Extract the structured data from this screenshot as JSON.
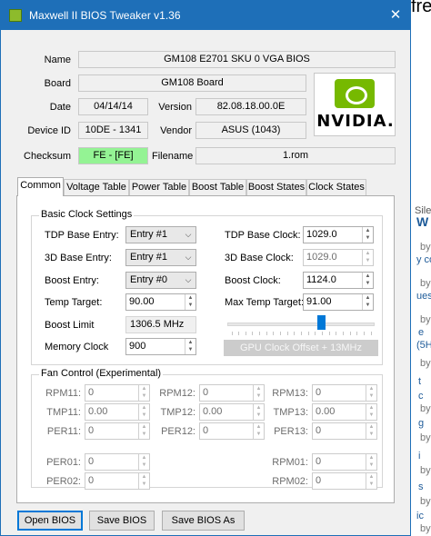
{
  "window": {
    "title": "Maxwell II BIOS Tweaker v1.36"
  },
  "info": {
    "name_label": "Name",
    "name_value": "GM108 E2701 SKU 0 VGA BIOS",
    "board_label": "Board",
    "board_value": "GM108 Board",
    "date_label": "Date",
    "date_value": "04/14/14",
    "version_label": "Version",
    "version_value": "82.08.18.00.0E",
    "device_label": "Device ID",
    "device_value": "10DE - 1341",
    "vendor_label": "Vendor",
    "vendor_value": "ASUS (1043)",
    "checksum_label": "Checksum",
    "checksum_value": "FE - [FE]",
    "filename_label": "Filename",
    "filename_value": "1.rom",
    "logo_text": "NVIDIA."
  },
  "tabs": [
    "Common",
    "Voltage Table",
    "Power Table",
    "Boost Table",
    "Boost States",
    "Clock States"
  ],
  "basic_clock": {
    "title": "Basic Clock Settings",
    "tdp_base_entry_label": "TDP Base Entry:",
    "tdp_base_entry_value": "Entry #1",
    "3d_base_entry_label": "3D Base Entry:",
    "3d_base_entry_value": "Entry #1",
    "boost_entry_label": "Boost Entry:",
    "boost_entry_value": "Entry #0",
    "temp_target_label": "Temp Target:",
    "temp_target_value": "90.00",
    "boost_limit_label": "Boost Limit",
    "boost_limit_value": "1306.5 MHz",
    "memory_clock_label": "Memory Clock",
    "memory_clock_value": "900",
    "tdp_base_clock_label": "TDP Base Clock:",
    "tdp_base_clock_value": "1029.0",
    "3d_base_clock_label": "3D Base Clock:",
    "3d_base_clock_value": "1029.0",
    "boost_clock_label": "Boost Clock:",
    "boost_clock_value": "1124.0",
    "max_temp_label": "Max Temp Target:",
    "max_temp_value": "91.00",
    "offset_slider_level": 0.65,
    "offset_button_label": "GPU Clock Offset + 13MHz"
  },
  "fan_control": {
    "title": "Fan Control (Experimental)",
    "col1": [
      {
        "label": "RPM11:",
        "value": "0"
      },
      {
        "label": "TMP11:",
        "value": "0.00"
      },
      {
        "label": "PER11:",
        "value": "0"
      }
    ],
    "col2": [
      {
        "label": "RPM12:",
        "value": "0"
      },
      {
        "label": "TMP12:",
        "value": "0.00"
      },
      {
        "label": "PER12:",
        "value": "0"
      }
    ],
    "col3": [
      {
        "label": "RPM13:",
        "value": "0"
      },
      {
        "label": "TMP13:",
        "value": "0.00"
      },
      {
        "label": "PER13:",
        "value": "0"
      }
    ],
    "per01_label": "PER01:",
    "per01_value": "0",
    "per02_label": "PER02:",
    "per02_value": "0",
    "rpm01_label": "RPM01:",
    "rpm01_value": "0",
    "rpm02_label": "RPM02:",
    "rpm02_value": "0"
  },
  "buttons": {
    "open": "Open BIOS",
    "save": "Save BIOS",
    "save_as": "Save BIOS As"
  },
  "background_fragments": [
    "fre",
    "Sile",
    "W",
    "by",
    "y co",
    "by",
    "ues",
    "by",
    "e",
    "(5H",
    "by",
    "t",
    "c",
    "by",
    "g",
    "by",
    "i",
    "by",
    "s",
    "by",
    "ic",
    "by"
  ]
}
